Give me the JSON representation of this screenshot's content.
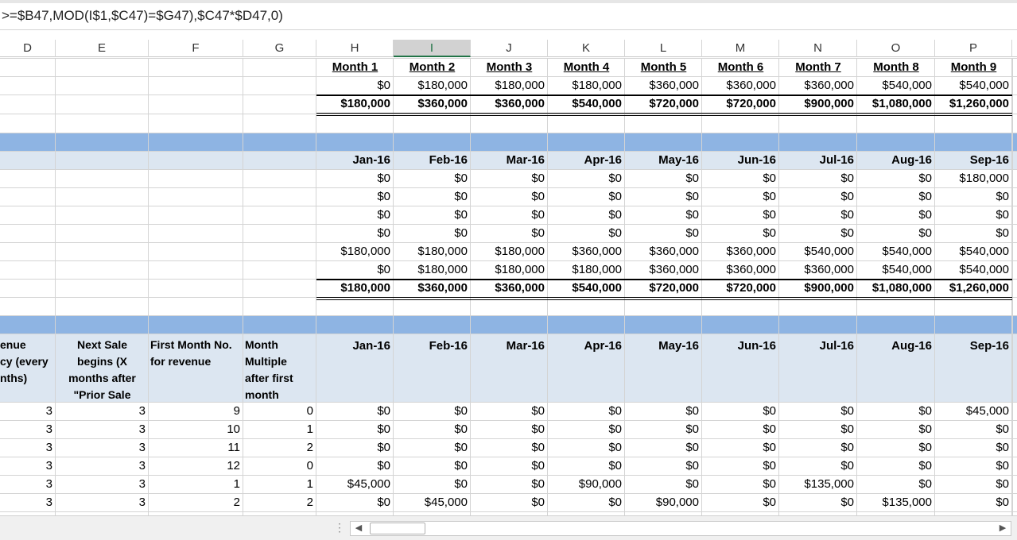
{
  "formula_bar": {
    "text": ">=$B47,MOD(I$1,$C47)=$G47),$C47*$D47,0)"
  },
  "columns": [
    "D",
    "E",
    "F",
    "G",
    "H",
    "I",
    "J",
    "K",
    "L",
    "M",
    "N",
    "O",
    "P"
  ],
  "selected_column": "I",
  "section1": {
    "months": [
      "Month 1",
      "Month 2",
      "Month 3",
      "Month 4",
      "Month 5",
      "Month 6",
      "Month 7",
      "Month 8",
      "Month 9"
    ],
    "row1": [
      "$0",
      "$180,000",
      "$180,000",
      "$180,000",
      "$360,000",
      "$360,000",
      "$360,000",
      "$540,000",
      "$540,000"
    ],
    "total": [
      "$180,000",
      "$360,000",
      "$360,000",
      "$540,000",
      "$720,000",
      "$720,000",
      "$900,000",
      "$1,080,000",
      "$1,260,000"
    ]
  },
  "section2": {
    "dates": [
      "Jan-16",
      "Feb-16",
      "Mar-16",
      "Apr-16",
      "May-16",
      "Jun-16",
      "Jul-16",
      "Aug-16",
      "Sep-16"
    ],
    "rows": [
      [
        "$0",
        "$0",
        "$0",
        "$0",
        "$0",
        "$0",
        "$0",
        "$0",
        "$180,000"
      ],
      [
        "$0",
        "$0",
        "$0",
        "$0",
        "$0",
        "$0",
        "$0",
        "$0",
        "$0"
      ],
      [
        "$0",
        "$0",
        "$0",
        "$0",
        "$0",
        "$0",
        "$0",
        "$0",
        "$0"
      ],
      [
        "$0",
        "$0",
        "$0",
        "$0",
        "$0",
        "$0",
        "$0",
        "$0",
        "$0"
      ],
      [
        "$180,000",
        "$180,000",
        "$180,000",
        "$360,000",
        "$360,000",
        "$360,000",
        "$540,000",
        "$540,000",
        "$540,000"
      ],
      [
        "$0",
        "$180,000",
        "$180,000",
        "$180,000",
        "$360,000",
        "$360,000",
        "$360,000",
        "$540,000",
        "$540,000"
      ]
    ],
    "total": [
      "$180,000",
      "$360,000",
      "$360,000",
      "$540,000",
      "$720,000",
      "$720,000",
      "$900,000",
      "$1,080,000",
      "$1,260,000"
    ]
  },
  "section3": {
    "headers": {
      "d": [
        "enue",
        "cy (every",
        "nths)"
      ],
      "e": [
        "Next Sale",
        "begins (X",
        "months after",
        "\"Prior Sale"
      ],
      "f": [
        "First Month No.",
        "for revenue"
      ],
      "g": [
        "Month",
        "Multiple",
        "after first",
        "month"
      ]
    },
    "dates": [
      "Jan-16",
      "Feb-16",
      "Mar-16",
      "Apr-16",
      "May-16",
      "Jun-16",
      "Jul-16",
      "Aug-16",
      "Sep-16"
    ],
    "rows": [
      {
        "d": "3",
        "e": "3",
        "f": "9",
        "g": "0",
        "vals": [
          "$0",
          "$0",
          "$0",
          "$0",
          "$0",
          "$0",
          "$0",
          "$0",
          "$45,000"
        ]
      },
      {
        "d": "3",
        "e": "3",
        "f": "10",
        "g": "1",
        "vals": [
          "$0",
          "$0",
          "$0",
          "$0",
          "$0",
          "$0",
          "$0",
          "$0",
          "$0"
        ]
      },
      {
        "d": "3",
        "e": "3",
        "f": "11",
        "g": "2",
        "vals": [
          "$0",
          "$0",
          "$0",
          "$0",
          "$0",
          "$0",
          "$0",
          "$0",
          "$0"
        ]
      },
      {
        "d": "3",
        "e": "3",
        "f": "12",
        "g": "0",
        "vals": [
          "$0",
          "$0",
          "$0",
          "$0",
          "$0",
          "$0",
          "$0",
          "$0",
          "$0"
        ]
      },
      {
        "d": "3",
        "e": "3",
        "f": "1",
        "g": "1",
        "vals": [
          "$45,000",
          "$0",
          "$0",
          "$90,000",
          "$0",
          "$0",
          "$135,000",
          "$0",
          "$0"
        ]
      },
      {
        "d": "3",
        "e": "3",
        "f": "2",
        "g": "2",
        "vals": [
          "$0",
          "$45,000",
          "$0",
          "$0",
          "$90,000",
          "$0",
          "$0",
          "$135,000",
          "$0"
        ]
      }
    ]
  },
  "status_bar": {
    "grip": "⋮",
    "scroll_left": "◀",
    "scroll_right": "▶"
  },
  "colors": {
    "band_dark": "#8eb4e3",
    "band_light": "#dce6f1",
    "selected_accent": "#217346"
  }
}
